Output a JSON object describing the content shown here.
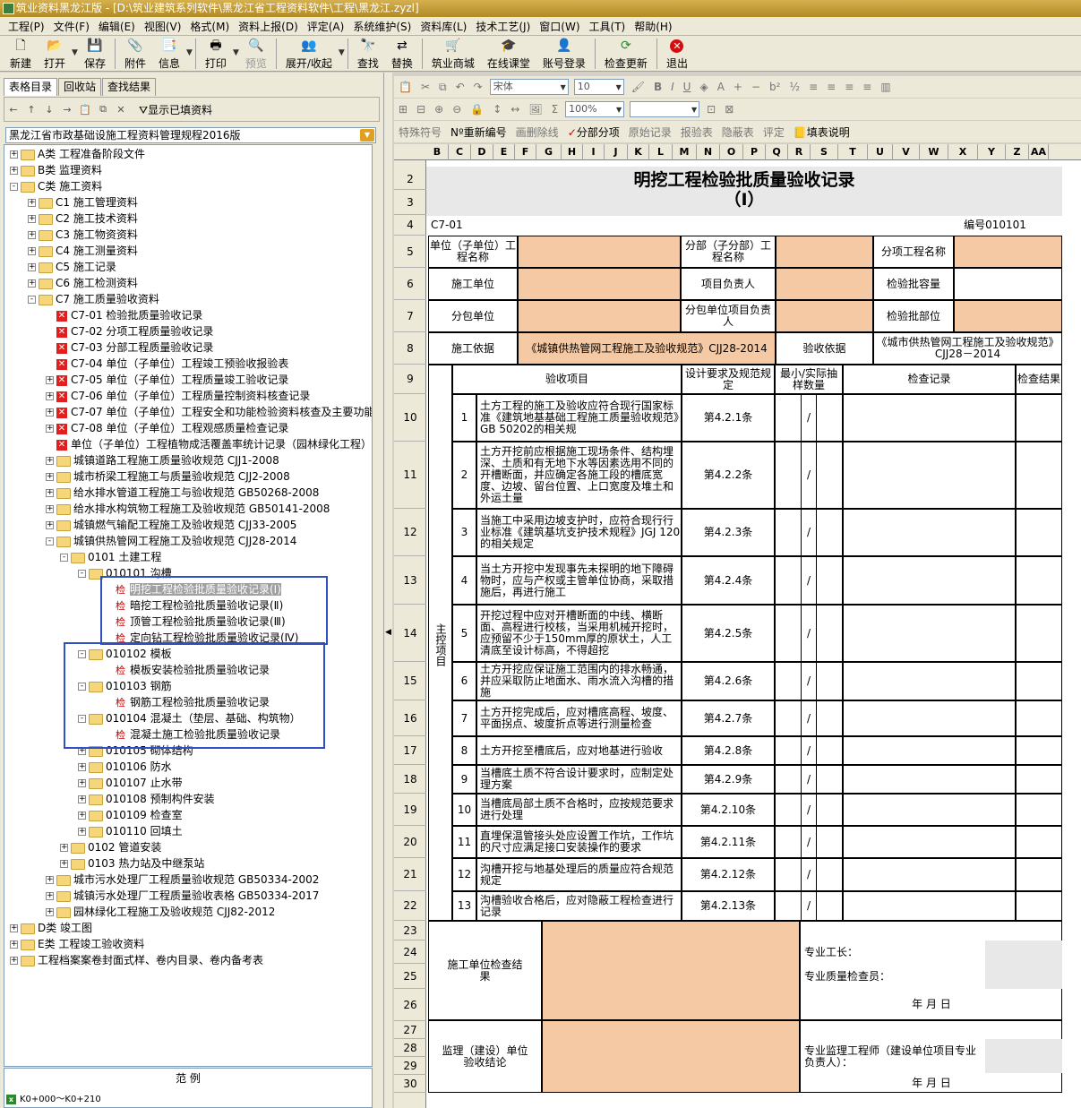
{
  "window": {
    "title": "筑业资料黑龙江版 - [D:\\筑业建筑系列软件\\黑龙江省工程资料软件\\工程\\黑龙江.zyzl]"
  },
  "menu": [
    "工程(P)",
    "文件(F)",
    "编辑(E)",
    "视图(V)",
    "格式(M)",
    "资料上报(D)",
    "评定(A)",
    "系统维护(S)",
    "资料库(L)",
    "技术工艺(J)",
    "窗口(W)",
    "工具(T)",
    "帮助(H)"
  ],
  "toolbar": {
    "new": "新建",
    "open": "打开",
    "save": "保存",
    "attach": "附件",
    "info": "信息",
    "print": "打印",
    "preview": "预览",
    "expand": "展开/收起",
    "find": "查找",
    "replace": "替换",
    "shop": "筑业商城",
    "classroom": "在线课堂",
    "login": "账号登录",
    "update": "检查更新",
    "exit": "退出"
  },
  "left_tabs": [
    "表格目录",
    "回收站",
    "查找结果"
  ],
  "show_filled": "显示已填资料",
  "standard_select": "黑龙江省市政基础设施工程资料管理规程2016版",
  "tree": [
    {
      "t": "A类 工程准备阶段文件",
      "lv": 0,
      "k": "f",
      "e": "+"
    },
    {
      "t": "B类 监理资料",
      "lv": 0,
      "k": "f",
      "e": "+"
    },
    {
      "t": "C类 施工资料",
      "lv": 0,
      "k": "f",
      "e": "-"
    },
    {
      "t": "C1 施工管理资料",
      "lv": 1,
      "k": "f",
      "e": "+"
    },
    {
      "t": "C2 施工技术资料",
      "lv": 1,
      "k": "f",
      "e": "+"
    },
    {
      "t": "C3 施工物资资料",
      "lv": 1,
      "k": "f",
      "e": "+"
    },
    {
      "t": "C4 施工测量资料",
      "lv": 1,
      "k": "f",
      "e": "+"
    },
    {
      "t": "C5 施工记录",
      "lv": 1,
      "k": "f",
      "e": "+"
    },
    {
      "t": "C6 施工检测资料",
      "lv": 1,
      "k": "f",
      "e": "+"
    },
    {
      "t": "C7 施工质量验收资料",
      "lv": 1,
      "k": "f",
      "e": "-"
    },
    {
      "t": "C7-01 检验批质量验收记录",
      "lv": 2,
      "k": "x",
      "e": ""
    },
    {
      "t": "C7-02 分项工程质量验收记录",
      "lv": 2,
      "k": "x",
      "e": ""
    },
    {
      "t": "C7-03 分部工程质量验收记录",
      "lv": 2,
      "k": "x",
      "e": ""
    },
    {
      "t": "C7-04 单位（子单位）工程竣工预验收报验表",
      "lv": 2,
      "k": "x",
      "e": ""
    },
    {
      "t": "C7-05 单位（子单位）工程质量竣工验收记录",
      "lv": 2,
      "k": "x",
      "e": "+"
    },
    {
      "t": "C7-06 单位（子单位）工程质量控制资料核查记录",
      "lv": 2,
      "k": "x",
      "e": "+"
    },
    {
      "t": "C7-07 单位（子单位）工程安全和功能检验资料核查及主要功能",
      "lv": 2,
      "k": "x",
      "e": "+"
    },
    {
      "t": "C7-08 单位（子单位）工程观感质量检查记录",
      "lv": 2,
      "k": "x",
      "e": "+"
    },
    {
      "t": "单位（子单位）工程植物成活覆盖率统计记录（园林绿化工程）",
      "lv": 2,
      "k": "x",
      "e": ""
    },
    {
      "t": "城镇道路工程施工质量验收规范 CJJ1-2008",
      "lv": 2,
      "k": "f",
      "e": "+"
    },
    {
      "t": "城市桥梁工程施工与质量验收规范 CJJ2-2008",
      "lv": 2,
      "k": "f",
      "e": "+"
    },
    {
      "t": "给水排水管道工程施工与验收规范 GB50268-2008",
      "lv": 2,
      "k": "f",
      "e": "+"
    },
    {
      "t": "给水排水构筑物工程施工及验收规范 GB50141-2008",
      "lv": 2,
      "k": "f",
      "e": "+"
    },
    {
      "t": "城镇燃气输配工程施工及验收规范 CJJ33-2005",
      "lv": 2,
      "k": "f",
      "e": "+"
    },
    {
      "t": "城镇供热管网工程施工及验收规范 CJJ28-2014",
      "lv": 2,
      "k": "f",
      "e": "-"
    },
    {
      "t": "0101 土建工程",
      "lv": 3,
      "k": "f",
      "e": "-"
    },
    {
      "t": "010101 沟槽",
      "lv": 4,
      "k": "f",
      "e": "-"
    },
    {
      "t": "明挖工程检验批质量验收记录(Ⅰ)",
      "lv": 5,
      "k": "j",
      "e": "",
      "sel": true
    },
    {
      "t": "暗挖工程检验批质量验收记录(Ⅱ)",
      "lv": 5,
      "k": "j",
      "e": ""
    },
    {
      "t": "顶管工程检验批质量验收记录(Ⅲ)",
      "lv": 5,
      "k": "j",
      "e": ""
    },
    {
      "t": "定向钻工程检验批质量验收记录(Ⅳ)",
      "lv": 5,
      "k": "j",
      "e": ""
    },
    {
      "t": "010102 模板",
      "lv": 4,
      "k": "f",
      "e": "-"
    },
    {
      "t": "模板安装检验批质量验收记录",
      "lv": 5,
      "k": "j",
      "e": ""
    },
    {
      "t": "010103 钢筋",
      "lv": 4,
      "k": "f",
      "e": "-"
    },
    {
      "t": "钢筋工程检验批质量验收记录",
      "lv": 5,
      "k": "j",
      "e": ""
    },
    {
      "t": "010104 混凝土（垫层、基础、构筑物）",
      "lv": 4,
      "k": "f",
      "e": "-"
    },
    {
      "t": "混凝土施工检验批质量验收记录",
      "lv": 5,
      "k": "j",
      "e": ""
    },
    {
      "t": "010105 砌体结构",
      "lv": 4,
      "k": "f",
      "e": "+"
    },
    {
      "t": "010106 防水",
      "lv": 4,
      "k": "f",
      "e": "+"
    },
    {
      "t": "010107 止水带",
      "lv": 4,
      "k": "f",
      "e": "+"
    },
    {
      "t": "010108 预制构件安装",
      "lv": 4,
      "k": "f",
      "e": "+"
    },
    {
      "t": "010109 检查室",
      "lv": 4,
      "k": "f",
      "e": "+"
    },
    {
      "t": "010110 回填土",
      "lv": 4,
      "k": "f",
      "e": "+"
    },
    {
      "t": "0102 管道安装",
      "lv": 3,
      "k": "f",
      "e": "+"
    },
    {
      "t": "0103 热力站及中继泵站",
      "lv": 3,
      "k": "f",
      "e": "+"
    },
    {
      "t": "城市污水处理厂工程质量验收规范 GB50334-2002",
      "lv": 2,
      "k": "f",
      "e": "+"
    },
    {
      "t": "城镇污水处理厂工程质量验收表格 GB50334-2017",
      "lv": 2,
      "k": "f",
      "e": "+"
    },
    {
      "t": "园林绿化工程施工及验收规范 CJJ82-2012",
      "lv": 2,
      "k": "f",
      "e": "+"
    },
    {
      "t": "D类 竣工图",
      "lv": 0,
      "k": "f",
      "e": "+"
    },
    {
      "t": "E类 工程竣工验收资料",
      "lv": 0,
      "k": "f",
      "e": "+"
    },
    {
      "t": "工程档案案卷封面式样、卷内目录、卷内备考表",
      "lv": 0,
      "k": "f",
      "e": "+"
    }
  ],
  "bottom_left": {
    "title": "范        例",
    "item": "K0+000～K0+210"
  },
  "right_toolbar1": {
    "font": "宋体",
    "size": "10"
  },
  "right_toolbar2": {
    "zoom": "100%"
  },
  "right_toolbar3": [
    "特殊符号",
    "重新编号",
    "画删除线",
    "分部分项",
    "原始记录",
    "报验表",
    "隐蔽表",
    "评定",
    "填表说明"
  ],
  "columns": [
    "B",
    "C",
    "D",
    "E",
    "F",
    "G",
    "H",
    "I",
    "J",
    "K",
    "L",
    "M",
    "N",
    "O",
    "P",
    "Q",
    "R",
    "S",
    "T",
    "U",
    "V",
    "W",
    "X",
    "Y",
    "Z",
    "AA"
  ],
  "rows": [
    "2",
    "3",
    "4",
    "5",
    "6",
    "7",
    "8",
    "9",
    "10",
    "11",
    "12",
    "13",
    "14",
    "15",
    "16",
    "17",
    "18",
    "19",
    "20",
    "21",
    "22",
    "23",
    "24",
    "25",
    "26",
    "27",
    "28",
    "29",
    "30"
  ],
  "form": {
    "title1": "明挖工程检验批质量验收记录",
    "title2": "（Ⅰ）",
    "code": "C7-01",
    "number": "编号010101",
    "unit_name": "单位（子单位）工程名称",
    "part_name": "分部（子分部）工程名称",
    "item_name": "分项工程名称",
    "constructor": "施工单位",
    "pm": "项目负责人",
    "capacity": "检验批容量",
    "sub": "分包单位",
    "sub_pm": "分包单位项目负责人",
    "location": "检验批部位",
    "basis_label": "施工依据",
    "basis": "《城镇供热管网工程施工及验收规范》CJJ28-2014",
    "acc_label": "验收依据",
    "acc": "《城市供热管网工程施工及验收规范》CJJ28－2014",
    "h_item": "验收项目",
    "h_spec": "设计要求及规范规定",
    "h_sample": "最小/实际抽样数量",
    "h_record": "检查记录",
    "h_result": "检查结果",
    "main_ctrl": "主控项目",
    "items": [
      {
        "n": "1",
        "d": "土方工程的施工及验收应符合现行国家标准《建筑地基基础工程施工质量验收规范》GB 50202的相关规",
        "s": "第4.2.1条",
        "m": "/"
      },
      {
        "n": "2",
        "d": "土方开挖前应根据施工现场条件、结构埋深、土质和有无地下水等因素选用不同的开槽断面，并应确定各施工段的槽底宽度、边坡、留台位置、上口宽度及堆土和外运土量",
        "s": "第4.2.2条",
        "m": "/"
      },
      {
        "n": "3",
        "d": "当施工中采用边坡支护时，应符合现行行业标准《建筑基坑支护技术规程》JGJ 120的相关规定",
        "s": "第4.2.3条",
        "m": "/"
      },
      {
        "n": "4",
        "d": "当土方开挖中发现事先未探明的地下障碍物时，应与产权或主管单位协商，采取措施后，再进行施工",
        "s": "第4.2.4条",
        "m": "/"
      },
      {
        "n": "5",
        "d": "开挖过程中应对开槽断面的中线、横断面、高程进行校核，当采用机械开挖时，应预留不少于150mm厚的原状土，人工清底至设计标高，不得超挖",
        "s": "第4.2.5条",
        "m": "/"
      },
      {
        "n": "6",
        "d": "土方开挖应保证施工范围内的排水畅通，并应采取防止地面水、雨水流入沟槽的措施",
        "s": "第4.2.6条",
        "m": "/"
      },
      {
        "n": "7",
        "d": "土方开挖完成后，应对槽底高程、坡度、平面拐点、坡度折点等进行测量检查",
        "s": "第4.2.7条",
        "m": "/"
      },
      {
        "n": "8",
        "d": "土方开挖至槽底后，应对地基进行验收",
        "s": "第4.2.8条",
        "m": "/"
      },
      {
        "n": "9",
        "d": "当槽底土质不符合设计要求时，应制定处理方案",
        "s": "第4.2.9条",
        "m": "/"
      },
      {
        "n": "10",
        "d": "当槽底局部土质不合格时，应按规范要求进行处理",
        "s": "第4.2.10条",
        "m": "/"
      },
      {
        "n": "11",
        "d": "直埋保温管接头处应设置工作坑，工作坑的尺寸应满足接口安装操作的要求",
        "s": "第4.2.11条",
        "m": "/"
      },
      {
        "n": "12",
        "d": "沟槽开挖与地基处理后的质量应符合规范规定",
        "s": "第4.2.12条",
        "m": "/"
      },
      {
        "n": "13",
        "d": "沟槽验收合格后，应对隐蔽工程检查进行记录",
        "s": "第4.2.13条",
        "m": "/"
      }
    ],
    "c_unit": "施工单位检查结果",
    "foreman": "专业工长：",
    "qc": "专业质量检查员：",
    "date": "年    月    日",
    "sup": "监理（建设）单位验收结论",
    "sup_eng": "专业监理工程师（建设单位项目专业负责人）："
  }
}
